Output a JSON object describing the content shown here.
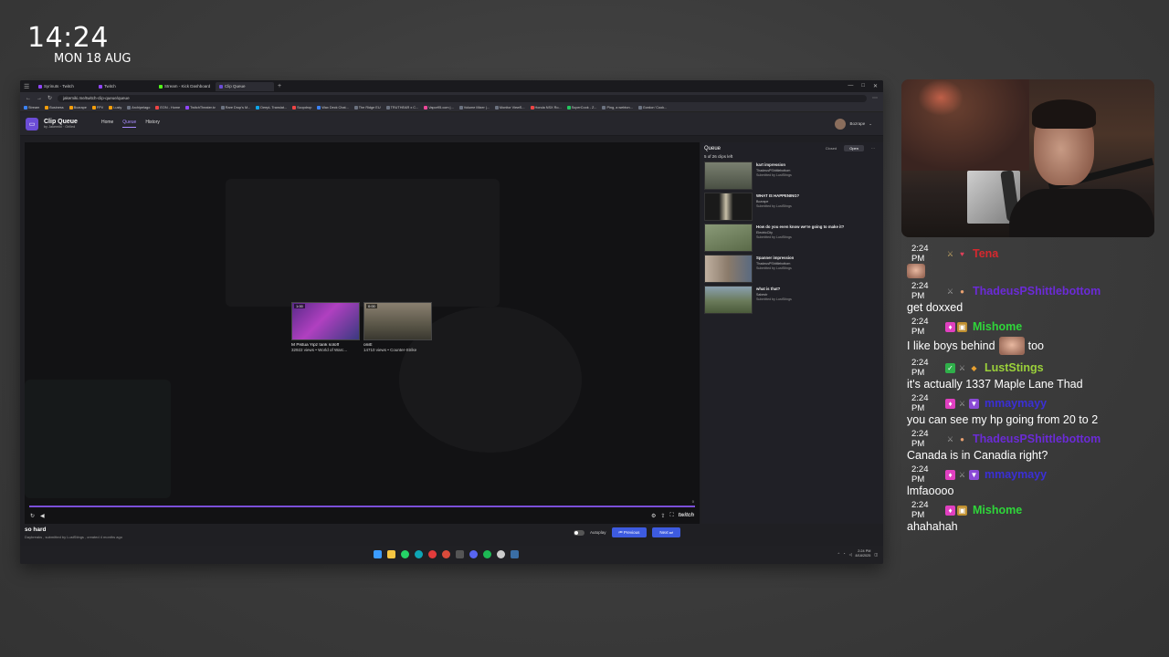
{
  "clock": {
    "time": "14:24",
    "date": "MON 18 AUG"
  },
  "browser": {
    "tabs": [
      {
        "label": "Syrinuts - Twitch",
        "active": false
      },
      {
        "label": "Twitch",
        "active": false
      },
      {
        "label": "Stream - Kick Dashboard",
        "active": false
      },
      {
        "label": "Clip Queue",
        "active": true
      }
    ],
    "url": "jakemiki.me/twitch-clip-queue/queue",
    "bookmarks": [
      "Stream",
      "Business",
      "Bozrape",
      "FPV",
      "Lusty",
      "Archipelago",
      "EON - Home",
      "TwitchTheater.tv",
      "Rare Drop's M...",
      "DeepL Translat...",
      "Scopdrop",
      "Wax Deck Chat...",
      "The Ridge EU",
      "TRUTHEAR x C...",
      "Vapor95.com |...",
      "Volume Mixer |...",
      "Monitor ViewS...",
      "Honda NSX Ro...",
      "SuperCook - Z...",
      "Ping, a webton...",
      "Gordon 'Cook..."
    ]
  },
  "app": {
    "title": "Clip Queue",
    "subtitle": "by Jakemiki · Grilled",
    "nav": [
      "Home",
      "Queue",
      "History"
    ],
    "user": "Bozrape"
  },
  "player": {
    "endcards": [
      {
        "duration": "1:00",
        "title": "M Pistua Yipz tank soloff",
        "meta": "32922 views • World of Warc..."
      },
      {
        "duration": "0:00",
        "title": "oniE",
        "meta": "14710 views • Counter-Strike"
      }
    ],
    "timecode": "0",
    "brand": "twitch"
  },
  "clip": {
    "title": "so hard",
    "meta": "Daybreaks , submitted by LustStings , created 4 months ago",
    "autoplay_label": "Autoplay",
    "prev_label": "Previous",
    "next_label": "Next"
  },
  "queue": {
    "title": "Queue",
    "toggle_closed": "Closed",
    "toggle_open": "Open",
    "count": "5 of 26 clips left",
    "items": [
      {
        "title": "kart impression",
        "author": "ThadeusPShittlebottom",
        "submitted": "Submitted by LustStings"
      },
      {
        "title": "WHAT IS HAPPENING?",
        "author": "Bozrape",
        "submitted": "Submitted by LustStings"
      },
      {
        "title": "How do you even know we're going to make it?",
        "author": "ElectricCity",
        "submitted": "Submitted by LustStings"
      },
      {
        "title": "Spanner impression",
        "author": "ThadeusPShittlebottom",
        "submitted": "Submitted by LustStings"
      },
      {
        "title": "what is that?",
        "author": "Sabestr",
        "submitted": "Submitted by LustStings"
      }
    ]
  },
  "taskbar": {
    "time": "2:24 PM",
    "date": "8/18/2025"
  },
  "chat": [
    {
      "time": "2:24 PM",
      "user": "Tena",
      "color": "#d6282e",
      "badges": [
        "sword",
        "heart"
      ],
      "text": "",
      "emote": "small"
    },
    {
      "time": "2:24 PM",
      "user": "ThadeusPShittlebottom",
      "color": "#6b2bd6",
      "badges": [
        "sword",
        "drop"
      ],
      "text": "get doxxed",
      "emote": ""
    },
    {
      "time": "2:24 PM",
      "user": "Mishome",
      "color": "#2fd63a",
      "badges": [
        "gem",
        "box"
      ],
      "text": "I like boys behind",
      "emote": "big",
      "text_after": "too"
    },
    {
      "time": "2:24 PM",
      "user": "LustStings",
      "color": "#9bd13a",
      "badges": [
        "check",
        "sword",
        "gift"
      ],
      "text": "it's actually 1337 Maple Lane Thad",
      "emote": ""
    },
    {
      "time": "2:24 PM",
      "user": "mmaymayy",
      "color": "#3b2fd6",
      "badges": [
        "gem",
        "sword",
        "cat"
      ],
      "text": "you can see my hp going from 20 to 2",
      "emote": ""
    },
    {
      "time": "2:24 PM",
      "user": "ThadeusPShittlebottom",
      "color": "#6b2bd6",
      "badges": [
        "sword",
        "drop"
      ],
      "text": "Canada is in Canadia right?",
      "emote": ""
    },
    {
      "time": "2:24 PM",
      "user": "mmaymayy",
      "color": "#3b2fd6",
      "badges": [
        "gem",
        "sword",
        "cat"
      ],
      "text": "lmfaoooo",
      "emote": ""
    },
    {
      "time": "2:24 PM",
      "user": "Mishome",
      "color": "#2fd63a",
      "badges": [
        "gem",
        "box"
      ],
      "text": "ahahahah",
      "emote": ""
    }
  ]
}
